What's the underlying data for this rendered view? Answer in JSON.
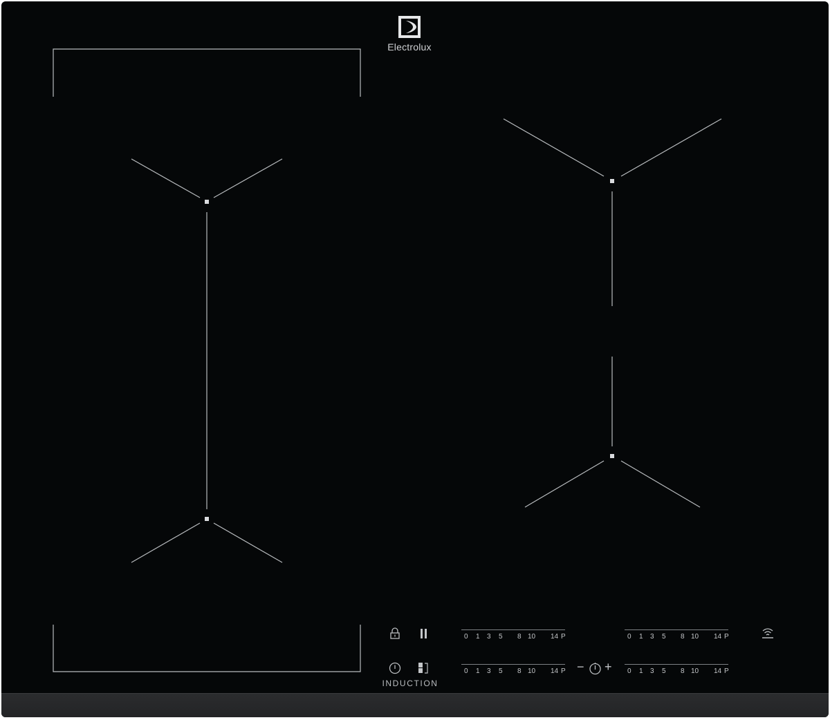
{
  "brand": {
    "name": "Electrolux",
    "logo_icon": "electrolux-logo-icon"
  },
  "controls": {
    "induction_label": "INDUCTION",
    "lock_icon": "lock-icon",
    "pause_icon": "pause-icon",
    "power_icon": "power-icon",
    "bridge_icon": "bridge-icon",
    "hob2hood_icon": "hob2hood-wifi-icon",
    "timer": {
      "minus": "−",
      "plus": "+",
      "icon": "timer-icon"
    }
  },
  "power_levels": [
    "0",
    "1",
    "3",
    "5",
    "8",
    "10",
    "14",
    "P"
  ],
  "sliders": [
    {
      "zone": "left-bridge-zone-rear"
    },
    {
      "zone": "right-rear-zone"
    },
    {
      "zone": "left-bridge-zone-front"
    },
    {
      "zone": "right-front-zone"
    }
  ],
  "zones": [
    {
      "name": "left-flexible-bridge-zone"
    },
    {
      "name": "right-rear-zone"
    },
    {
      "name": "right-front-zone"
    }
  ],
  "colors": {
    "glass": "#050708",
    "markings": "#b9bcbf",
    "frame_edge": "#2b2c2e"
  }
}
